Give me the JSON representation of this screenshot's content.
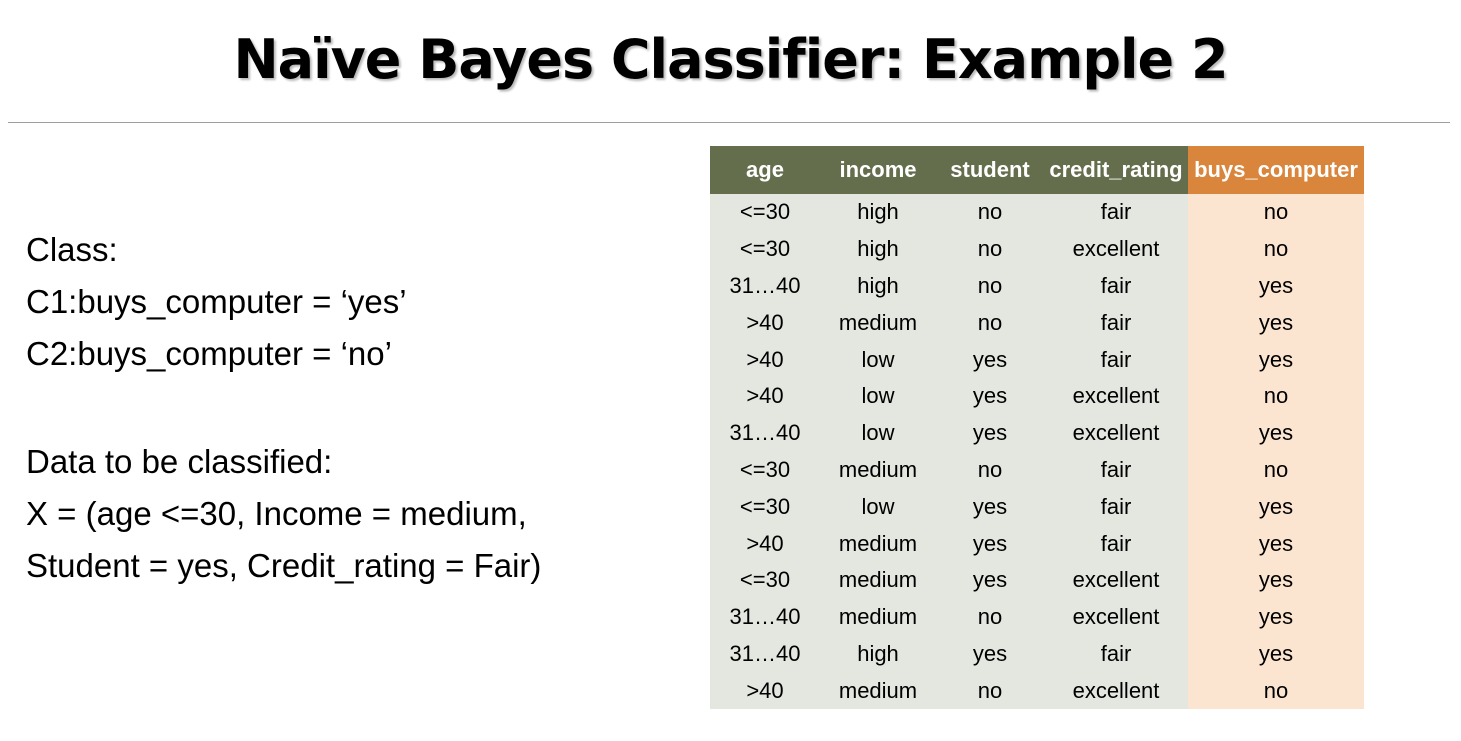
{
  "title": "Naïve Bayes Classifier: Example 2",
  "left": {
    "class_label": "Class:",
    "c1": "C1:buys_computer = ‘yes’",
    "c2": "C2:buys_computer = ‘no’",
    "data_label": "Data to be classified:",
    "x_line1": "X = (age <=30, Income = medium,",
    "x_line2": "Student = yes, Credit_rating = Fair)"
  },
  "table": {
    "headers": [
      "age",
      "income",
      "student",
      "credit_rating",
      "buys_computer"
    ],
    "rows": [
      [
        "<=30",
        "high",
        "no",
        "fair",
        "no"
      ],
      [
        "<=30",
        "high",
        "no",
        "excellent",
        "no"
      ],
      [
        "31…40",
        "high",
        "no",
        "fair",
        "yes"
      ],
      [
        ">40",
        "medium",
        "no",
        "fair",
        "yes"
      ],
      [
        ">40",
        "low",
        "yes",
        "fair",
        "yes"
      ],
      [
        ">40",
        "low",
        "yes",
        "excellent",
        "no"
      ],
      [
        "31…40",
        "low",
        "yes",
        "excellent",
        "yes"
      ],
      [
        "<=30",
        "medium",
        "no",
        "fair",
        "no"
      ],
      [
        "<=30",
        "low",
        "yes",
        "fair",
        "yes"
      ],
      [
        ">40",
        "medium",
        "yes",
        "fair",
        "yes"
      ],
      [
        "<=30",
        "medium",
        "yes",
        "excellent",
        "yes"
      ],
      [
        "31…40",
        "medium",
        "no",
        "excellent",
        "yes"
      ],
      [
        "31…40",
        "high",
        "yes",
        "fair",
        "yes"
      ],
      [
        ">40",
        "medium",
        "no",
        "excellent",
        "no"
      ]
    ]
  },
  "colors": {
    "header_bg": "#646e4c",
    "target_header_bg": "#d9853b",
    "cell_bg": "#e3e7e0",
    "target_cell_bg": "#fbe5d0"
  }
}
